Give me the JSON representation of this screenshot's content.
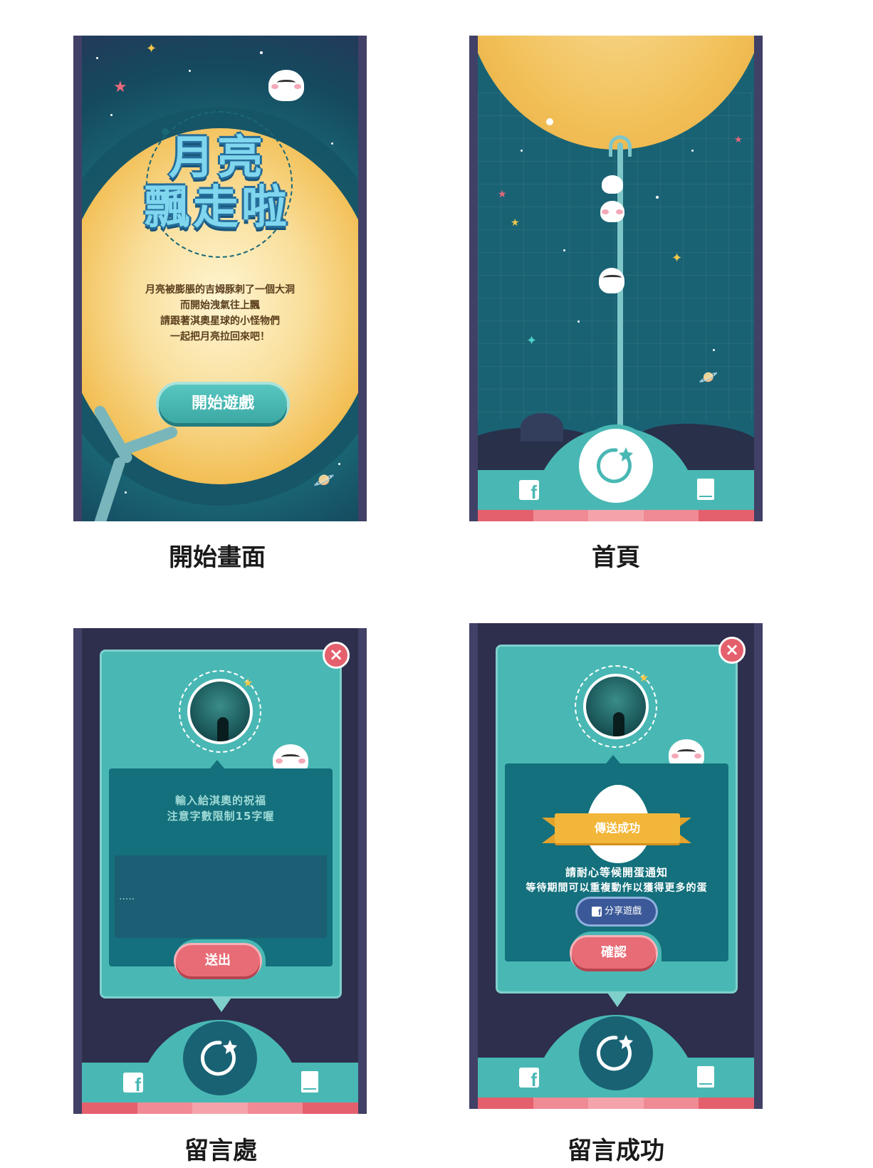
{
  "captions": {
    "start": "開始畫面",
    "home": "首頁",
    "message": "留言處",
    "success": "留言成功"
  },
  "start_screen": {
    "title_line1": "月亮",
    "title_line2": "飄走啦",
    "intro": [
      "月亮被膨脹的吉姆豚刺了一個大洞",
      "而開始洩氣往上飄",
      "請跟著淇奧星球的小怪物們",
      "一起把月亮拉回來吧！"
    ],
    "start_button": "開始遊戲"
  },
  "message_screen": {
    "prompt_line1": "輸入給淇奧的祝福",
    "prompt_line2": "注意字數限制15字喔",
    "input_value": ".....",
    "submit_button": "送出",
    "close_icon": "×"
  },
  "success_screen": {
    "ribbon": "傳送成功",
    "line1": "請耐心等候開蛋通知",
    "line2": "等待期間可以重複動作以獲得更多的蛋",
    "share_button": "分享遊戲",
    "confirm_button": "確認",
    "close_icon": "×"
  },
  "nav": {
    "fb_icon": "facebook-icon",
    "center_icon": "reload-star-icon",
    "book_icon": "book-icon",
    "fb_glyph": "f",
    "share_glyph": "f"
  },
  "colors": {
    "teal": "#49b8b4",
    "dark_teal": "#196274",
    "frame": "#414066",
    "night": "#2e2e4d",
    "moon": "#f2c15a",
    "pink": "#e86c76",
    "stripes": [
      "#e4606d",
      "#f08a95",
      "#f4a3ab",
      "#f08a95",
      "#e4606d"
    ]
  }
}
